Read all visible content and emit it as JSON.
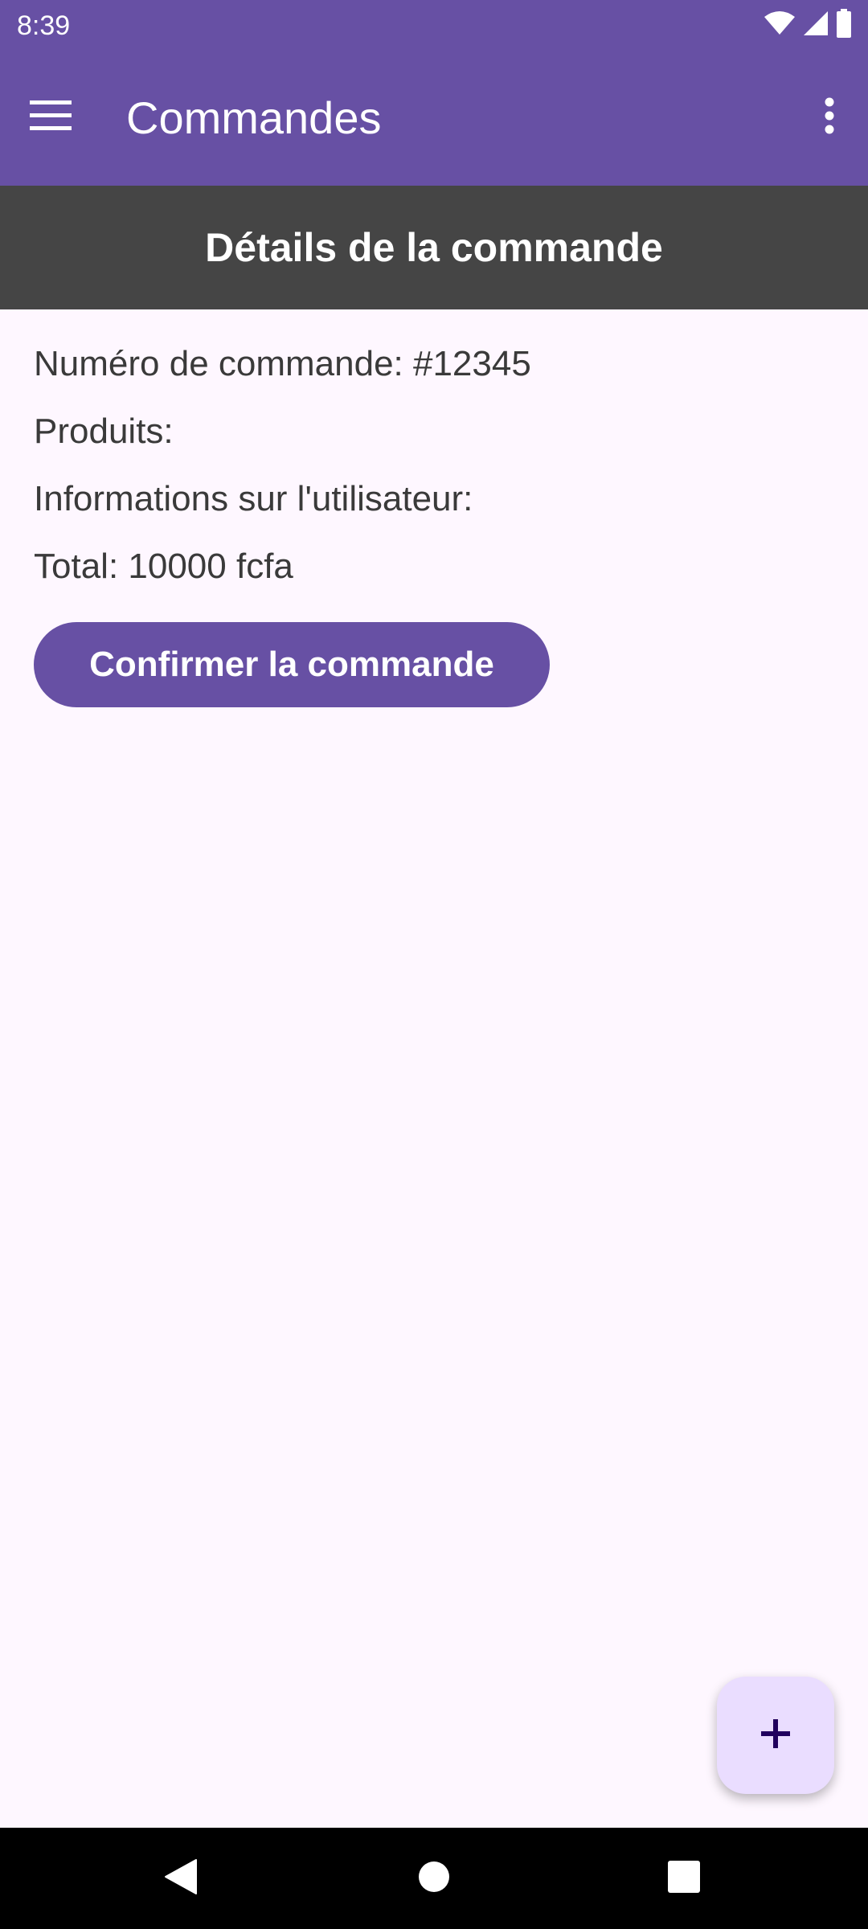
{
  "status_bar": {
    "time": "8:39",
    "icons": [
      "wifi-icon",
      "signal-icon",
      "battery-icon"
    ]
  },
  "app_bar": {
    "title": "Commandes",
    "menu_icon": "hamburger-menu-icon",
    "overflow_icon": "more-vert-icon"
  },
  "section": {
    "title": "Détails de la commande"
  },
  "order": {
    "number_line": "Numéro de commande: #12345",
    "products_line": "Produits:",
    "user_info_line": "Informations sur l'utilisateur:",
    "total_line": "Total: 10000 fcfa"
  },
  "actions": {
    "confirm_label": "Confirmer la commande"
  },
  "fab": {
    "icon": "plus-icon"
  },
  "nav_bar": {
    "icons": [
      "back-icon",
      "home-icon",
      "recents-icon"
    ]
  },
  "colors": {
    "primary": "#6750A4",
    "header_bar": "#454545",
    "background": "#FEF7FF",
    "fab_container": "#EADDFF",
    "fab_icon": "#21005D"
  }
}
